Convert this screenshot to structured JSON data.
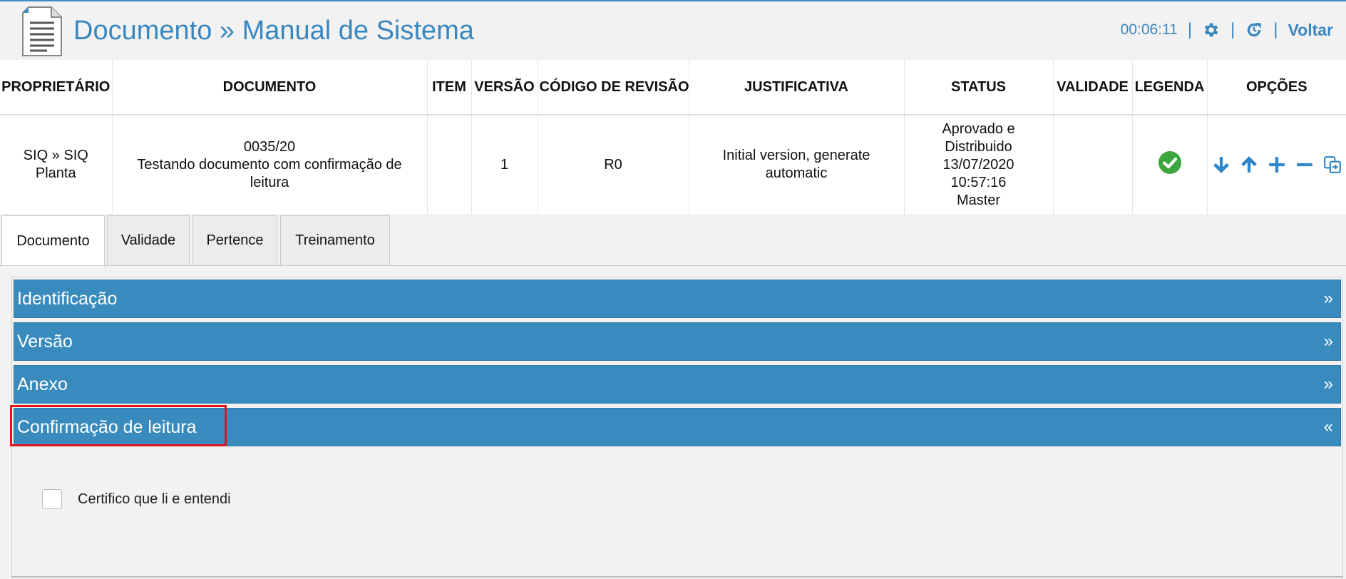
{
  "header": {
    "title": "Documento » Manual de Sistema",
    "timer": "00:06:11",
    "separator": "|",
    "back_label": "Voltar",
    "icons": [
      "document-icon",
      "gear-icon",
      "refresh-icon"
    ],
    "accent_color": "#3a87bf"
  },
  "table": {
    "columns": [
      "PROPRIETÁRIO",
      "DOCUMENTO",
      "ITEM",
      "VERSÃO",
      "CÓDIGO DE REVISÃO",
      "JUSTIFICATIVA",
      "STATUS",
      "VALIDADE",
      "LEGENDA",
      "OPÇÕES"
    ],
    "row": {
      "proprietario": [
        "SIQ » SIQ",
        "Planta"
      ],
      "documento": [
        "0035/20",
        "Testando documento com confirmação de",
        "leitura"
      ],
      "item": "",
      "versao": "1",
      "codigo_revisao": "R0",
      "justificativa": [
        "Initial version, generate",
        "automatic"
      ],
      "status": [
        "Aprovado e",
        "Distribuido",
        "13/07/2020",
        "10:57:16",
        "Master"
      ],
      "validade": "",
      "legenda_icon": "check-circle-icon",
      "legenda_color": "#3fa63f",
      "opcoes_icons": [
        "arrow-down-icon",
        "arrow-up-icon",
        "plus-icon",
        "minus-icon",
        "copy-icon"
      ]
    }
  },
  "tabs": [
    {
      "label": "Documento",
      "active": true
    },
    {
      "label": "Validade",
      "active": false
    },
    {
      "label": "Pertence",
      "active": false
    },
    {
      "label": "Treinamento",
      "active": false
    }
  ],
  "accordion": [
    {
      "label": "Identificação",
      "chevron": "»"
    },
    {
      "label": "Versão",
      "chevron": "»"
    },
    {
      "label": "Anexo",
      "chevron": "»"
    },
    {
      "label": "Confirmação de leitura",
      "chevron": "«"
    }
  ],
  "confirmation": {
    "checkbox_label": "Certifico que li e entendi",
    "checked": false
  },
  "colors": {
    "accordion_bg": "#3a8bbd",
    "highlight": "#e0161b"
  }
}
